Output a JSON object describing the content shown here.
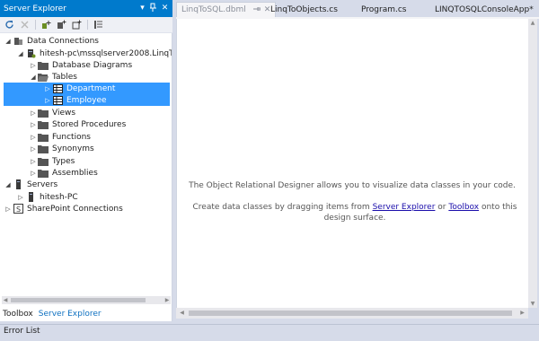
{
  "panel": {
    "title": "Server Explorer",
    "pin_glyph": "⭥",
    "close_glyph": "✕",
    "dropdown_glyph": "▾"
  },
  "tree": {
    "data_connections": "Data Connections",
    "connection": "hitesh-pc\\mssqlserver2008.LinqTo",
    "database_diagrams": "Database Diagrams",
    "tables": "Tables",
    "department": "Department",
    "employee": "Employee",
    "views": "Views",
    "stored_procedures": "Stored Procedures",
    "functions": "Functions",
    "synonyms": "Synonyms",
    "types": "Types",
    "assemblies": "Assemblies",
    "servers": "Servers",
    "hitesh_pc": "hitesh-PC",
    "sharepoint": "SharePoint Connections"
  },
  "bottom_tabs": {
    "toolbox": "Toolbox",
    "server_explorer": "Server Explorer"
  },
  "error_list": "Error List",
  "editor_tabs": {
    "dbml": "LinqToSQL.dbml",
    "objects": "LinqToObjects.cs",
    "program": "Program.cs",
    "console": "LINQTOSQLConsoleApp*"
  },
  "editor": {
    "line1": "The Object Relational Designer allows you to visualize data classes in your code.",
    "line2_before": "Create data classes by dragging items from ",
    "link_server_explorer": "Server Explorer",
    "line2_or": " or ",
    "link_toolbox": "Toolbox",
    "line2_after": " onto this design surface."
  },
  "colors": {
    "accent": "#007acc",
    "selection": "#3399ff",
    "background": "#d6dbe9"
  }
}
